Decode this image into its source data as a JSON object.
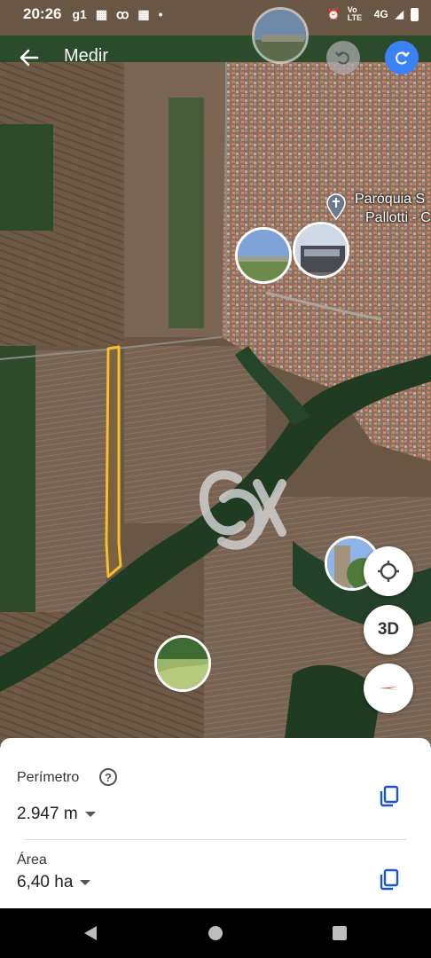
{
  "status_bar": {
    "time": "20:26",
    "app_icon_text": "g1",
    "network": "4G",
    "volte": "Vo LTE"
  },
  "header": {
    "title": "Medir"
  },
  "map": {
    "place_label_line1": "Paróquia S",
    "place_label_line2": "Pallotti - C"
  },
  "controls": {
    "three_d_label": "3D"
  },
  "metrics": {
    "perimeter_label": "Perímetro",
    "perimeter_value": "2.947 m",
    "area_label": "Área",
    "area_value": "6,40 ha"
  },
  "colors": {
    "accent_blue": "#3b82f6",
    "measure_line": "#f5c02a",
    "copy_icon": "#1a56c4"
  }
}
